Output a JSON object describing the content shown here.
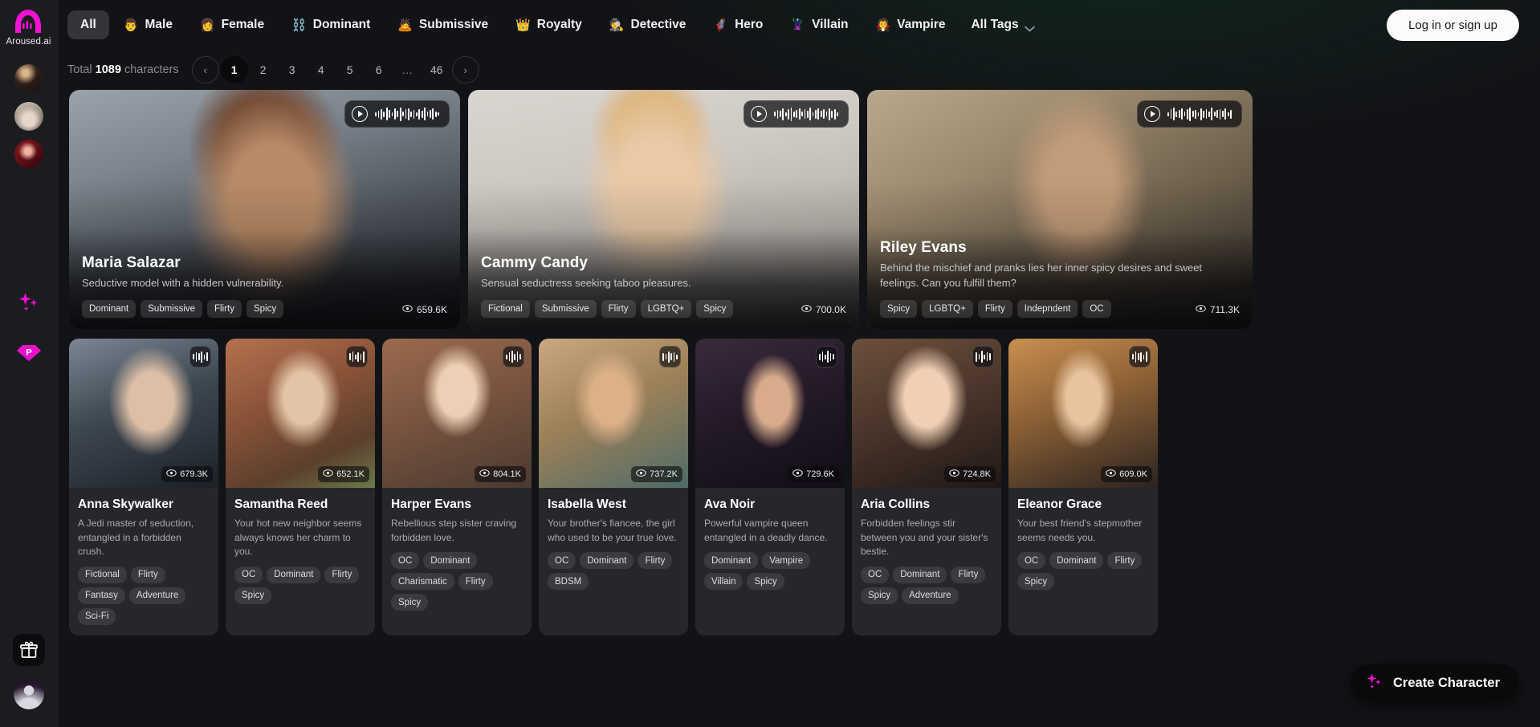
{
  "brand": {
    "name": "Aroused.ai",
    "accent": "#f312d2",
    "logo_icon": "aroused-logo-icon"
  },
  "sidebar": {
    "avatars": [
      {
        "name": "sidebar-avatar-1"
      },
      {
        "name": "sidebar-avatar-2"
      },
      {
        "name": "sidebar-avatar-3"
      }
    ],
    "icons": [
      {
        "name": "sparkles-icon",
        "color": "#f312d2"
      },
      {
        "name": "premium-diamond-icon",
        "color": "#f312d2",
        "letter": "P"
      }
    ],
    "bottom_icons": [
      {
        "name": "gift-icon"
      },
      {
        "name": "user-profile-avatar"
      }
    ]
  },
  "topnav": {
    "tabs": [
      {
        "label": "All",
        "emoji": "",
        "active": true
      },
      {
        "label": "Male",
        "emoji": "👨",
        "active": false
      },
      {
        "label": "Female",
        "emoji": "👩",
        "active": false
      },
      {
        "label": "Dominant",
        "emoji": "⛓️",
        "active": false
      },
      {
        "label": "Submissive",
        "emoji": "🙇",
        "active": false
      },
      {
        "label": "Royalty",
        "emoji": "👑",
        "active": false
      },
      {
        "label": "Detective",
        "emoji": "🕵️",
        "active": false
      },
      {
        "label": "Hero",
        "emoji": "🦸",
        "active": false
      },
      {
        "label": "Villain",
        "emoji": "🦹",
        "active": false
      },
      {
        "label": "Vampire",
        "emoji": "🧛",
        "active": false
      }
    ],
    "all_tags_label": "All Tags",
    "login_label": "Log in or sign up"
  },
  "pagination": {
    "total_prefix": "Total",
    "total_count": "1089",
    "total_suffix": "characters",
    "prev_label": "‹",
    "next_label": "›",
    "pages": [
      "1",
      "2",
      "3",
      "4",
      "5",
      "6",
      "…",
      "46"
    ],
    "current": "1"
  },
  "featured": [
    {
      "name": "Maria Salazar",
      "description": "Seductive model with a hidden vulnerability.",
      "tags": [
        "Dominant",
        "Submissive",
        "Flirty",
        "Spicy"
      ],
      "views": "659.6K",
      "has_audio": true
    },
    {
      "name": "Cammy Candy",
      "description": "Sensual seductress seeking taboo pleasures.",
      "tags": [
        "Fictional",
        "Submissive",
        "Flirty",
        "LGBTQ+",
        "Spicy"
      ],
      "views": "700.0K",
      "has_audio": true
    },
    {
      "name": "Riley Evans",
      "description": "Behind the mischief and pranks lies her inner spicy desires and sweet feelings. Can you fulfill them?",
      "tags": [
        "Spicy",
        "LGBTQ+",
        "Flirty",
        "Indepndent",
        "OC"
      ],
      "views": "711.3K",
      "has_audio": true
    }
  ],
  "characters": [
    {
      "name": "Anna Skywalker",
      "description": "A Jedi master of seduction, entangled in a forbidden crush.",
      "tags": [
        "Fictional",
        "Flirty",
        "Fantasy",
        "Adventure",
        "Sci-Fi"
      ],
      "views": "679.3K"
    },
    {
      "name": "Samantha Reed",
      "description": "Your hot new neighbor seems always knows her charm to you.",
      "tags": [
        "OC",
        "Dominant",
        "Flirty",
        "Spicy"
      ],
      "views": "652.1K"
    },
    {
      "name": "Harper Evans",
      "description": "Rebellious step sister craving forbidden love.",
      "tags": [
        "OC",
        "Dominant",
        "Charismatic",
        "Flirty",
        "Spicy"
      ],
      "views": "804.1K"
    },
    {
      "name": "Isabella West",
      "description": "Your brother's fiancee, the girl who used to be your true love.",
      "tags": [
        "OC",
        "Dominant",
        "Flirty",
        "BDSM"
      ],
      "views": "737.2K"
    },
    {
      "name": "Ava Noir",
      "description": "Powerful vampire queen entangled in a deadly dance.",
      "tags": [
        "Dominant",
        "Vampire",
        "Villain",
        "Spicy"
      ],
      "views": "729.6K"
    },
    {
      "name": "Aria Collins",
      "description": "Forbidden feelings stir between you and your sister's bestie.",
      "tags": [
        "OC",
        "Dominant",
        "Flirty",
        "Spicy",
        "Adventure"
      ],
      "views": "724.8K"
    },
    {
      "name": "Eleanor Grace",
      "description": "Your best friend's stepmother seems needs you.",
      "tags": [
        "OC",
        "Dominant",
        "Flirty",
        "Spicy"
      ],
      "views": "609.0K"
    }
  ],
  "cta": {
    "label": "Create Character",
    "icon": "sparkles-icon"
  }
}
